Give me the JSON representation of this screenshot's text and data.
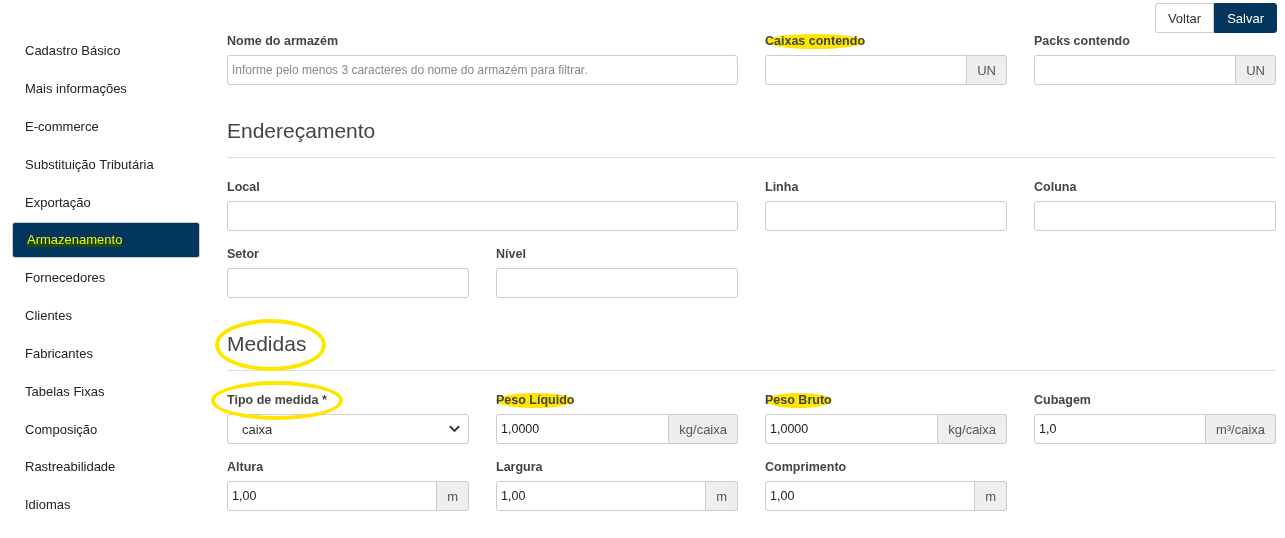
{
  "actions": [
    {
      "label": "Voltar",
      "kind": "secondary"
    },
    {
      "label": "Salvar",
      "kind": "primary"
    }
  ],
  "sidebar": {
    "items": [
      {
        "label": "Cadastro Básico",
        "selected": false,
        "highlighted": false
      },
      {
        "label": "Mais informações",
        "selected": false,
        "highlighted": false
      },
      {
        "label": "E-commerce",
        "selected": false,
        "highlighted": false
      },
      {
        "label": "Substituição Tributária",
        "selected": false,
        "highlighted": false
      },
      {
        "label": "Exportação",
        "selected": false,
        "highlighted": false
      },
      {
        "label": "Armazenamento",
        "selected": true,
        "highlighted": true
      },
      {
        "label": "Fornecedores",
        "selected": false,
        "highlighted": false
      },
      {
        "label": "Clientes",
        "selected": false,
        "highlighted": false
      },
      {
        "label": "Fabricantes",
        "selected": false,
        "highlighted": false
      },
      {
        "label": "Tabelas Fixas",
        "selected": false,
        "highlighted": false
      },
      {
        "label": "Composição",
        "selected": false,
        "highlighted": false
      },
      {
        "label": "Rastreabilidade",
        "selected": false,
        "highlighted": false
      },
      {
        "label": "Idiomas",
        "selected": false,
        "highlighted": false
      }
    ]
  },
  "sections": [
    {
      "rows": [
        [
          {
            "label": "Nome do armazém",
            "kind": "text",
            "wide": true,
            "highlighted": false,
            "circled": false,
            "placeholder": "Informe pelo menos 3 caracteres do nome do armazém para filtrar."
          },
          {
            "label": "Caixas contendo",
            "kind": "addon",
            "wide": false,
            "highlighted": true,
            "circled": false,
            "unit": "UN"
          },
          {
            "label": "Packs contendo",
            "kind": "addon",
            "wide": false,
            "highlighted": false,
            "circled": false,
            "unit": "UN"
          }
        ]
      ]
    },
    {
      "title": "Endereçamento",
      "circled": false,
      "rows": [
        [
          {
            "label": "Local",
            "kind": "text",
            "wide": true,
            "highlighted": false,
            "circled": false
          },
          {
            "label": "Linha",
            "kind": "text",
            "wide": false,
            "highlighted": false,
            "circled": false
          },
          {
            "label": "Coluna",
            "kind": "text",
            "wide": false,
            "highlighted": false,
            "circled": false
          }
        ],
        [
          {
            "label": "Setor",
            "kind": "text",
            "wide": false,
            "highlighted": false,
            "circled": false
          },
          {
            "label": "Nível",
            "kind": "text",
            "wide": false,
            "highlighted": false,
            "circled": false
          }
        ]
      ]
    },
    {
      "title": "Medidas",
      "circled": true,
      "rows": [
        [
          {
            "label": "Tipo de medida *",
            "kind": "select",
            "wide": false,
            "highlighted": false,
            "circled": true,
            "value": "caixa"
          },
          {
            "label": "Peso Líquido",
            "kind": "addon",
            "wide": false,
            "highlighted": true,
            "circled": false,
            "value": "1,0000",
            "unit": "kg/caixa"
          },
          {
            "label": "Peso Bruto",
            "kind": "addon",
            "wide": false,
            "highlighted": true,
            "circled": false,
            "value": "1,0000",
            "unit": "kg/caixa"
          },
          {
            "label": "Cubagem",
            "kind": "addon",
            "wide": false,
            "highlighted": false,
            "circled": false,
            "value": "1,0",
            "unit": "m³/caixa"
          }
        ],
        [
          {
            "label": "Altura",
            "kind": "addon",
            "wide": false,
            "highlighted": false,
            "circled": false,
            "value": "1,00",
            "unit": "m"
          },
          {
            "label": "Largura",
            "kind": "addon",
            "wide": false,
            "highlighted": false,
            "circled": false,
            "value": "1,00",
            "unit": "m"
          },
          {
            "label": "Comprimento",
            "kind": "addon",
            "wide": false,
            "highlighted": false,
            "circled": false,
            "value": "1,00",
            "unit": "m"
          }
        ]
      ]
    }
  ]
}
